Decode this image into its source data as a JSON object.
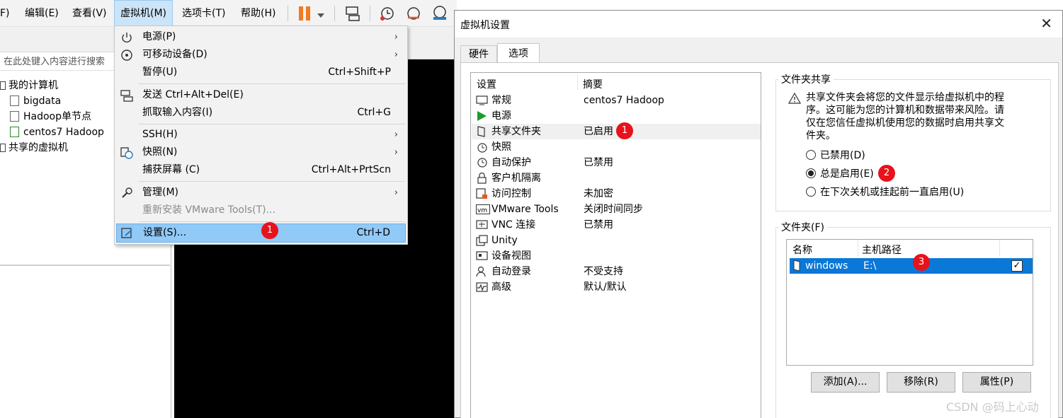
{
  "menubar": {
    "items": [
      "F)",
      "编辑(E)",
      "查看(V)",
      "虚拟机(M)",
      "选项卡(T)",
      "帮助(H)"
    ],
    "pause_color": "#f07a22"
  },
  "library": {
    "search_placeholder": "在此处键入内容进行搜索",
    "my_computer": "我的计算机",
    "vms": [
      "bigdata",
      "Hadoop单节点",
      "centos7 Hadoop"
    ],
    "shared": "共享的虚拟机"
  },
  "vm_menu": {
    "items": [
      {
        "label": "电源(P)",
        "accel": "",
        "submenu": true,
        "icon": "power-icon"
      },
      {
        "label": "可移动设备(D)",
        "accel": "",
        "submenu": true,
        "icon": "removable-device-icon"
      },
      {
        "label": "暂停(U)",
        "accel": "Ctrl+Shift+P",
        "submenu": false,
        "icon": ""
      },
      {
        "label": "发送 Ctrl+Alt+Del(E)",
        "accel": "",
        "submenu": false,
        "icon": "send-keys-icon"
      },
      {
        "label": "抓取输入内容(I)",
        "accel": "Ctrl+G",
        "submenu": false,
        "icon": ""
      },
      {
        "label": "SSH(H)",
        "accel": "",
        "submenu": true,
        "icon": ""
      },
      {
        "label": "快照(N)",
        "accel": "",
        "submenu": true,
        "icon": "snapshot-icon"
      },
      {
        "label": "捕获屏幕 (C)",
        "accel": "Ctrl+Alt+PrtScn",
        "submenu": false,
        "icon": ""
      },
      {
        "label": "管理(M)",
        "accel": "",
        "submenu": true,
        "icon": "wrench-icon"
      },
      {
        "label": "重新安装 VMware Tools(T)...",
        "accel": "",
        "submenu": false,
        "icon": "",
        "disabled": true
      },
      {
        "label": "设置(S)...",
        "accel": "Ctrl+D",
        "submenu": false,
        "icon": "settings-icon",
        "highlighted": true
      }
    ]
  },
  "badges": [
    "1",
    "1",
    "2",
    "3"
  ],
  "dialog": {
    "title": "虚拟机设置",
    "close": "✕",
    "tabs": [
      "硬件",
      "选项"
    ],
    "list_headers": [
      "设置",
      "摘要"
    ],
    "rows": [
      {
        "name": "常规",
        "summary": "centos7 Hadoop"
      },
      {
        "name": "电源",
        "summary": ""
      },
      {
        "name": "共享文件夹",
        "summary": "已启用"
      },
      {
        "name": "快照",
        "summary": ""
      },
      {
        "name": "自动保护",
        "summary": "已禁用"
      },
      {
        "name": "客户机隔离",
        "summary": ""
      },
      {
        "name": "访问控制",
        "summary": "未加密"
      },
      {
        "name": "VMware Tools",
        "summary": "关闭时间同步"
      },
      {
        "name": "VNC 连接",
        "summary": "已禁用"
      },
      {
        "name": "Unity",
        "summary": ""
      },
      {
        "name": "设备视图",
        "summary": ""
      },
      {
        "name": "自动登录",
        "summary": "不受支持"
      },
      {
        "name": "高级",
        "summary": "默认/默认"
      }
    ],
    "sharing": {
      "title": "文件夹共享",
      "warning": "共享文件夹会将您的文件显示给虚拟机中的程序。这可能为您的计算机和数据带来风险。请仅在您信任虚拟机使用您的数据时启用共享文件夹。",
      "options": [
        "已禁用(D)",
        "总是启用(E)",
        "在下次关机或挂起前一直启用(U)"
      ],
      "selected": 1
    },
    "folders": {
      "title": "文件夹(F)",
      "headers": [
        "名称",
        "主机路径"
      ],
      "row": {
        "name": "windows",
        "path": "E:\\",
        "checked": "✓"
      }
    },
    "buttons": [
      "添加(A)...",
      "移除(R)",
      "属性(P)"
    ]
  },
  "watermark": "CSDN @码上心动"
}
